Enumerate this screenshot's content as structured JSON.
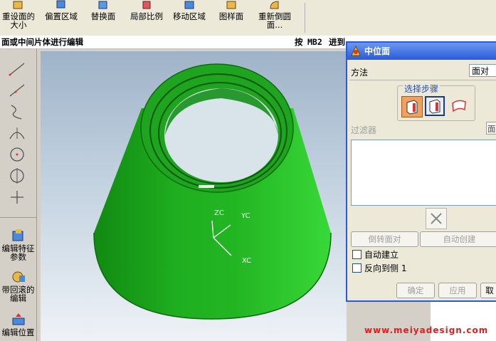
{
  "toolbar": {
    "buttons": [
      {
        "line1": "重设面的",
        "line2": "大小"
      },
      {
        "line1": "偏置区域",
        "line2": ""
      },
      {
        "line1": "替换面",
        "line2": ""
      },
      {
        "line1": "局部比例",
        "line2": ""
      },
      {
        "line1": "移动区域",
        "line2": ""
      },
      {
        "line1": "图样面",
        "line2": ""
      },
      {
        "line1": "重新倒圆",
        "line2": "面..."
      }
    ]
  },
  "status": {
    "prompt": "面或中间片体进行编辑",
    "hint_prefix": "按",
    "hint_key": "MB2",
    "hint_suffix": "进到"
  },
  "palette": {
    "buttons": [
      {
        "line1": "编辑特征",
        "line2": "参数"
      },
      {
        "line1": "带回滚的",
        "line2": "编辑"
      },
      {
        "line1": "编辑位置",
        "line2": ""
      }
    ]
  },
  "viewport": {
    "axes": {
      "zc": "ZC",
      "yc": "YC",
      "xc": "XC"
    },
    "model_color": "#2fbf2f"
  },
  "dialog": {
    "title": "中位面",
    "method_label": "方法",
    "method_value": "面对",
    "steps_label": "选择步骤",
    "filter_label": "过滤器",
    "filter_value": "面",
    "reverse_pair_button": "倒转面对",
    "auto_create_button": "自动创建",
    "auto_build_label": "自动建立",
    "reverse_side_label": "反向到侧 1",
    "ok_button": "确定",
    "apply_button": "应用",
    "cancel_button": "取"
  },
  "watermark": "www.meiyadesign.com",
  "colors": {
    "title_bar": "#2a5bd7",
    "accent_orange": "#f0a060",
    "watermark": "#e02020"
  }
}
